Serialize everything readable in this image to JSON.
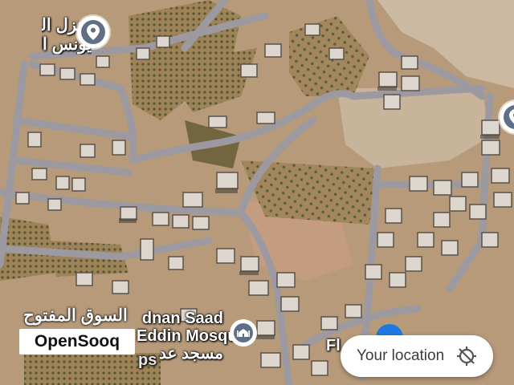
{
  "map": {
    "place_top_left": {
      "line1": "منزل الحا",
      "line2": "يونس الح"
    },
    "mosque": {
      "line1": "dnan Saad",
      "line2": "Eddin Mosque",
      "line3": "مسجد عد"
    },
    "partial_label": "Fl",
    "partial_label_2": "ps"
  },
  "location_button": {
    "label": "Your location",
    "icon": "locate-crosshair-icon"
  },
  "brand": {
    "name_ar": "السوق المفتوح",
    "name_en": "OpenSooq"
  },
  "colors": {
    "pin_fill": "#5f6f86",
    "location_dot": "#1f7ae0",
    "ground": "#b69a7a",
    "road": "#9c9aa0"
  }
}
